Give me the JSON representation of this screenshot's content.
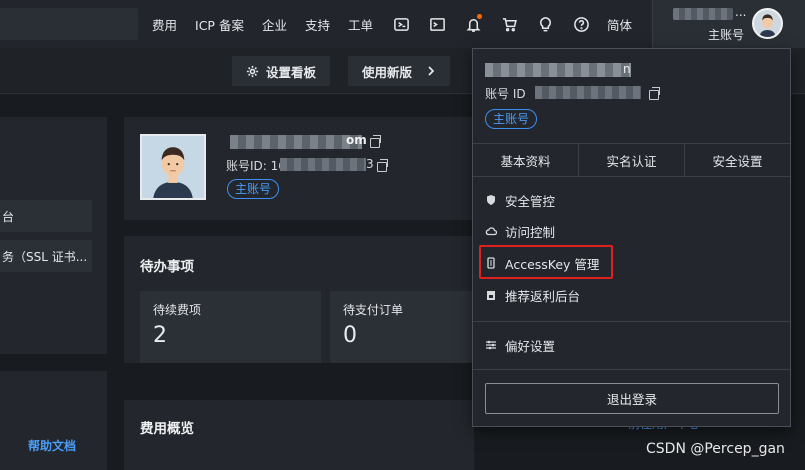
{
  "topnav": {
    "links": [
      "费用",
      "ICP 备案",
      "企业",
      "支持",
      "工单"
    ],
    "language": "简体",
    "user_ellipsis": "...",
    "user_role": "主账号"
  },
  "toolbar": {
    "dashboard_settings": "设置看板",
    "use_new_version": "使用新版"
  },
  "left_panel": {
    "items": [
      "台",
      "务（SSL 证书..."
    ],
    "help_link": "帮助文档"
  },
  "profile_card": {
    "name_suffix": "om",
    "id_label": "账号ID: 16",
    "id_suffix": "3",
    "badge": "主账号"
  },
  "todo": {
    "title": "待办事项",
    "items": [
      {
        "label": "待续费项",
        "value": "2"
      },
      {
        "label": "待支付订单",
        "value": "0"
      }
    ]
  },
  "fees": {
    "title": "费用概览"
  },
  "partner_link": "前往用户中心",
  "dropdown": {
    "name_suffix": "n",
    "id_label": "账号 ID",
    "badge": "主账号",
    "tabs": [
      "基本资料",
      "实名认证",
      "安全设置"
    ],
    "menu": [
      "安全管控",
      "访问控制",
      "AccessKey 管理",
      "推荐返利后台",
      "偏好设置"
    ],
    "logout": "退出登录"
  },
  "watermark": "CSDN @Percep_gan"
}
